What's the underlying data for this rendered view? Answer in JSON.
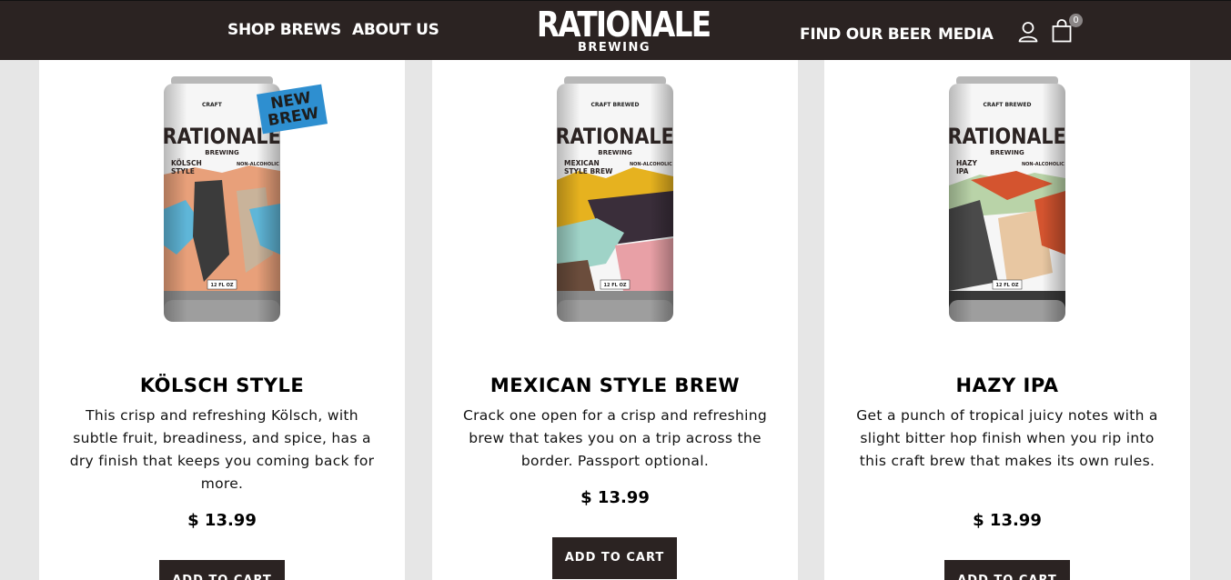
{
  "nav": {
    "shop": "SHOP BREWS",
    "about": "ABOUT US",
    "find": "FIND OUR BEER",
    "media": "MEDIA",
    "cart_count": "0"
  },
  "logo": {
    "main": "RATIONALE",
    "sub": "BREWING"
  },
  "products": [
    {
      "name": "KÖLSCH STYLE",
      "description": "This crisp and refreshing Kölsch, with subtle fruit, breadiness, and spice, has a dry finish that keeps you coming back for more.",
      "price": "$ 13.99",
      "button": "ADD TO CART",
      "badge": "NEW BREW",
      "can": {
        "top_label": "CRAFT",
        "brand": "RATIONALE",
        "brand_sub": "BREWING",
        "style": "KÖLSCH STYLE",
        "non_alc": "NON-ALCOHOLIC",
        "volume": "12 FL OZ",
        "colors": [
          "#e8a07a",
          "#5fb6d8",
          "#3b3b3b",
          "#c9b39a"
        ]
      }
    },
    {
      "name": "MEXICAN STYLE BREW",
      "description": "Crack one open for a crisp and refreshing brew that takes you on a trip across the border. Passport optional.",
      "price": "$ 13.99",
      "button": "ADD TO CART",
      "can": {
        "top_label": "CRAFT BREWED",
        "brand": "RATIONALE",
        "brand_sub": "BREWING",
        "style": "MEXICAN STYLE BREW",
        "non_alc": "NON-ALCOHOLIC",
        "volume": "12 FL OZ",
        "colors": [
          "#e6b21f",
          "#3a2e3a",
          "#9fd3c7",
          "#e8a0a6"
        ]
      }
    },
    {
      "name": "HAZY IPA",
      "description": "Get a punch of tropical juicy notes with a slight bitter hop finish when you rip into this craft brew that makes its own rules.",
      "price": "$ 13.99",
      "button": "ADD TO CART",
      "can": {
        "top_label": "CRAFT BREWED",
        "brand": "RATIONALE",
        "brand_sub": "BREWING",
        "style": "HAZY IPA",
        "non_alc": "NON-ALCOHOLIC",
        "volume": "12 FL OZ",
        "colors": [
          "#d4542f",
          "#b9d3a8",
          "#4a4a4a",
          "#e8c7a2"
        ]
      }
    }
  ],
  "icons": {
    "user": "user-icon",
    "cart": "shopping-bag-icon"
  }
}
